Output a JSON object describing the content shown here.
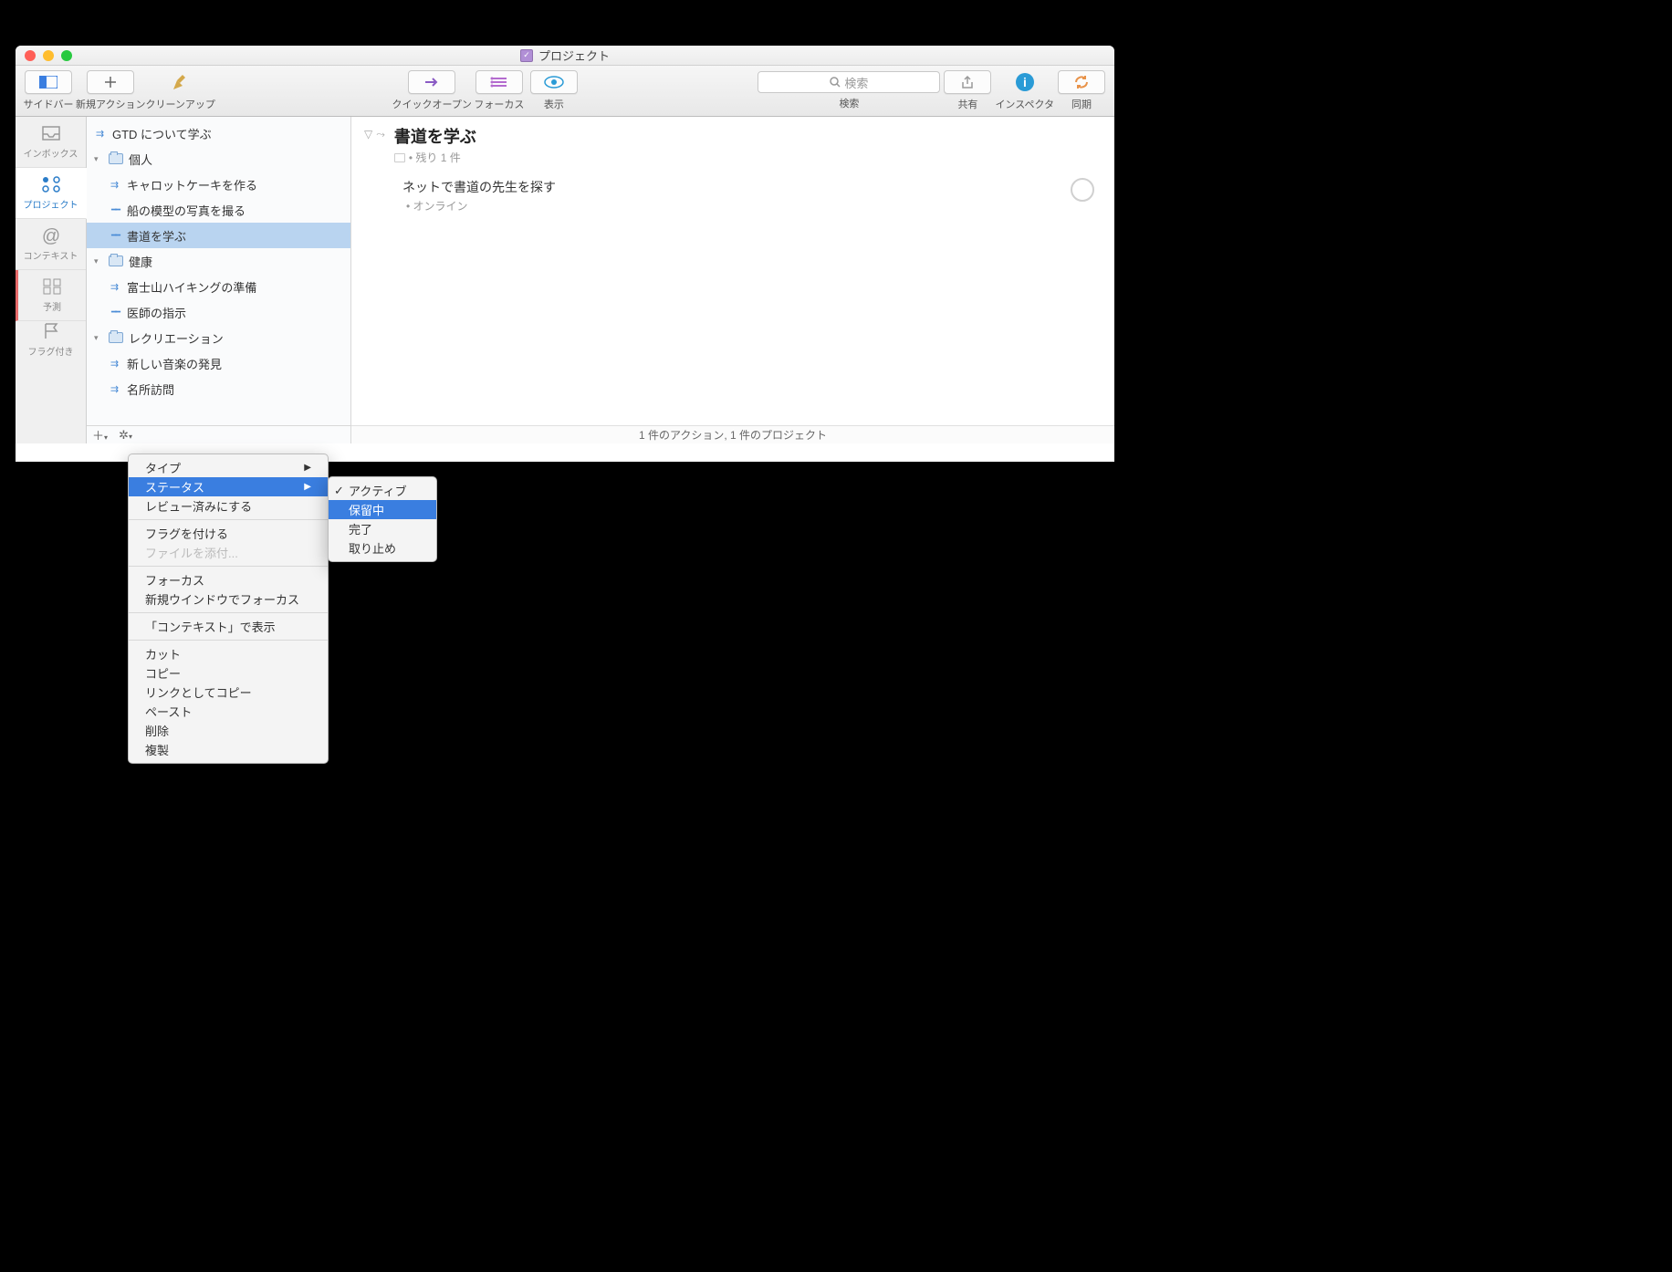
{
  "window_title": "プロジェクト",
  "toolbar": {
    "sidebar": "サイドバー",
    "new_action": "新規アクション",
    "cleanup": "クリーンアップ",
    "quick_open": "クイックオープン",
    "focus": "フォーカス",
    "view": "表示",
    "search_placeholder": "検索",
    "search_label": "検索",
    "share": "共有",
    "inspector": "インスペクタ",
    "sync": "同期"
  },
  "perspectives": {
    "inbox": "インボックス",
    "projects": "プロジェクト",
    "contexts": "コンテキスト",
    "forecast": "予測",
    "flagged": "フラグ付き"
  },
  "sidebar": {
    "items": [
      {
        "type": "par",
        "label": "GTD について学ぶ",
        "level": 0
      },
      {
        "type": "folder",
        "label": "個人",
        "level": 0,
        "open": true
      },
      {
        "type": "par",
        "label": "キャロットケーキを作る",
        "level": 1
      },
      {
        "type": "seq",
        "label": "船の模型の写真を撮る",
        "level": 1
      },
      {
        "type": "seq",
        "label": "書道を学ぶ",
        "level": 1,
        "selected": true
      },
      {
        "type": "folder",
        "label": "健康",
        "level": 0,
        "open": true
      },
      {
        "type": "par",
        "label": "富士山ハイキングの準備",
        "level": 1
      },
      {
        "type": "seq",
        "label": "医師の指示",
        "level": 1
      },
      {
        "type": "folder",
        "label": "レクリエーション",
        "level": 0,
        "open": true
      },
      {
        "type": "par",
        "label": "新しい音楽の発見",
        "level": 1
      },
      {
        "type": "par",
        "label": "名所訪問",
        "level": 1
      }
    ]
  },
  "main": {
    "project_title": "書道を学ぶ",
    "project_sub": "• 残り 1 件",
    "task_title": "ネットで書道の先生を探す",
    "task_sub": "• オンライン"
  },
  "status_bar": "1 件のアクション, 1 件のプロジェクト",
  "context_menu": {
    "items": [
      {
        "label": "タイプ",
        "arrow": true
      },
      {
        "label": "ステータス",
        "arrow": true,
        "hl": true
      },
      {
        "label": "レビュー済みにする"
      },
      {
        "sep": true
      },
      {
        "label": "フラグを付ける"
      },
      {
        "label": "ファイルを添付...",
        "disabled": true
      },
      {
        "sep": true
      },
      {
        "label": "フォーカス"
      },
      {
        "label": "新規ウインドウでフォーカス"
      },
      {
        "sep": true
      },
      {
        "label": "「コンテキスト」で表示"
      },
      {
        "sep": true
      },
      {
        "label": "カット"
      },
      {
        "label": "コピー"
      },
      {
        "label": "リンクとしてコピー"
      },
      {
        "label": "ペースト"
      },
      {
        "label": "削除"
      },
      {
        "label": "複製"
      }
    ]
  },
  "submenu": {
    "items": [
      {
        "label": "アクティブ",
        "checked": true
      },
      {
        "label": "保留中",
        "hl": true
      },
      {
        "label": "完了"
      },
      {
        "label": "取り止め"
      }
    ]
  }
}
